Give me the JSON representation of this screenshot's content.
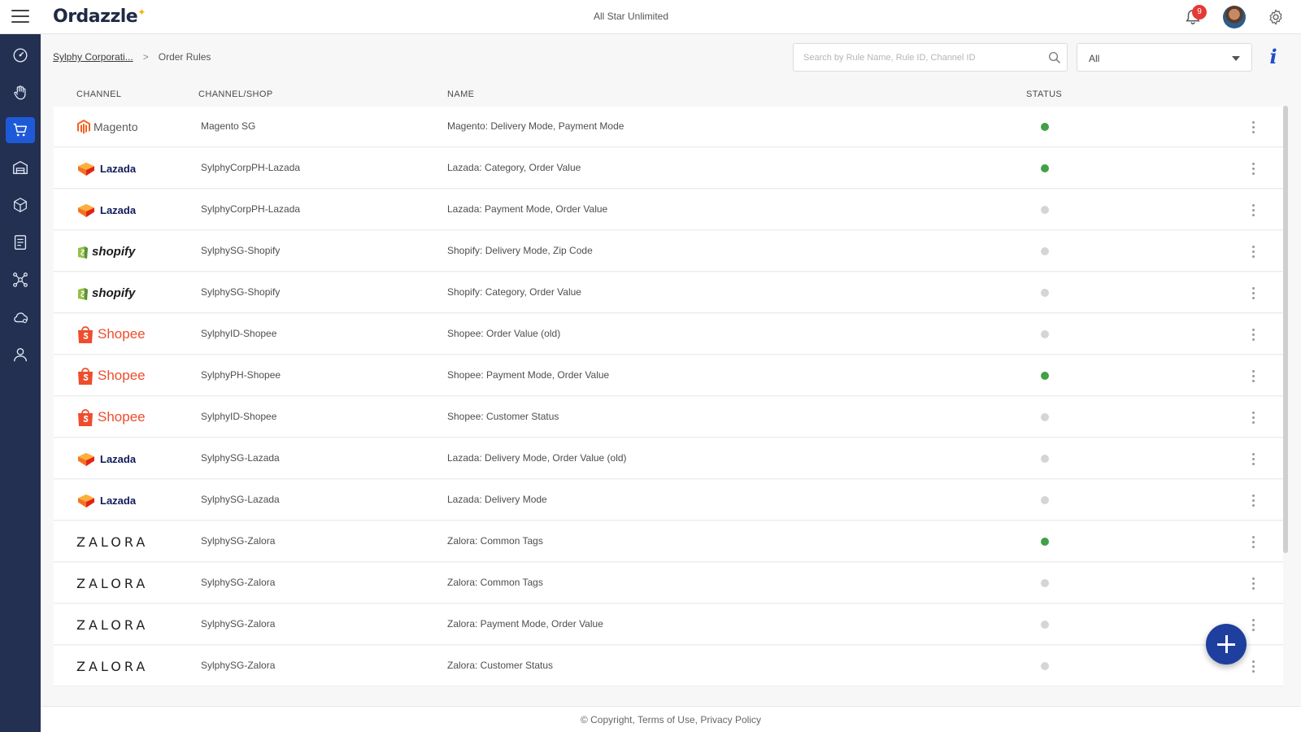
{
  "app": {
    "logo_text": "Ordazzle",
    "company": "All Star Unlimited"
  },
  "header": {
    "notification_count": "9"
  },
  "breadcrumb": {
    "parent": "Sylphy Corporati...",
    "current": "Order Rules"
  },
  "search": {
    "placeholder": "Search by Rule Name, Rule ID, Channel ID",
    "value": ""
  },
  "filter": {
    "selected": "All"
  },
  "info_label": "i",
  "table": {
    "columns": {
      "channel": "CHANNEL",
      "shop": "CHANNEL/SHOP",
      "name": "NAME",
      "status": "STATUS"
    },
    "rows": [
      {
        "channel": "Magento",
        "shop": "Magento SG",
        "name": "Magento: Delivery Mode, Payment Mode",
        "active": true
      },
      {
        "channel": "Lazada",
        "shop": "SylphyCorpPH-Lazada",
        "name": "Lazada: Category, Order Value",
        "active": true
      },
      {
        "channel": "Lazada",
        "shop": "SylphyCorpPH-Lazada",
        "name": "Lazada: Payment Mode, Order Value",
        "active": false
      },
      {
        "channel": "shopify",
        "shop": "SylphySG-Shopify",
        "name": "Shopify: Delivery Mode, Zip Code",
        "active": false
      },
      {
        "channel": "shopify",
        "shop": "SylphySG-Shopify",
        "name": "Shopify: Category, Order Value",
        "active": false
      },
      {
        "channel": "Shopee",
        "shop": "SylphyID-Shopee",
        "name": "Shopee: Order Value (old)",
        "active": false
      },
      {
        "channel": "Shopee",
        "shop": "SylphyPH-Shopee",
        "name": "Shopee: Payment Mode, Order Value",
        "active": true
      },
      {
        "channel": "Shopee",
        "shop": "SylphyID-Shopee",
        "name": "Shopee: Customer Status",
        "active": false
      },
      {
        "channel": "Lazada",
        "shop": "SylphySG-Lazada",
        "name": "Lazada: Delivery Mode, Order Value (old)",
        "active": false
      },
      {
        "channel": "Lazada",
        "shop": "SylphySG-Lazada",
        "name": "Lazada: Delivery Mode",
        "active": false
      },
      {
        "channel": "ZALORA",
        "shop": "SylphySG-Zalora",
        "name": "Zalora: Common Tags",
        "active": true
      },
      {
        "channel": "ZALORA",
        "shop": "SylphySG-Zalora",
        "name": "Zalora: Common Tags",
        "active": false
      },
      {
        "channel": "ZALORA",
        "shop": "SylphySG-Zalora",
        "name": "Zalora: Payment Mode, Order Value",
        "active": false
      },
      {
        "channel": "ZALORA",
        "shop": "SylphySG-Zalora",
        "name": "Zalora: Customer Status",
        "active": false
      }
    ]
  },
  "colors": {
    "sidebar": "#243051",
    "accent": "#1e5ad8",
    "status_active": "#43a047",
    "status_inactive": "#d5d5d5",
    "fab": "#1e3f9e"
  },
  "sidebar_icons": [
    "dashboard-icon",
    "hand-icon",
    "cart-icon",
    "warehouse-icon",
    "box-icon",
    "ledger-icon",
    "network-icon",
    "cloud-sync-icon",
    "user-icon"
  ],
  "footer": {
    "copyright": "©  Copyright",
    "terms": "Terms of Use",
    "privacy": "Privacy Policy"
  }
}
